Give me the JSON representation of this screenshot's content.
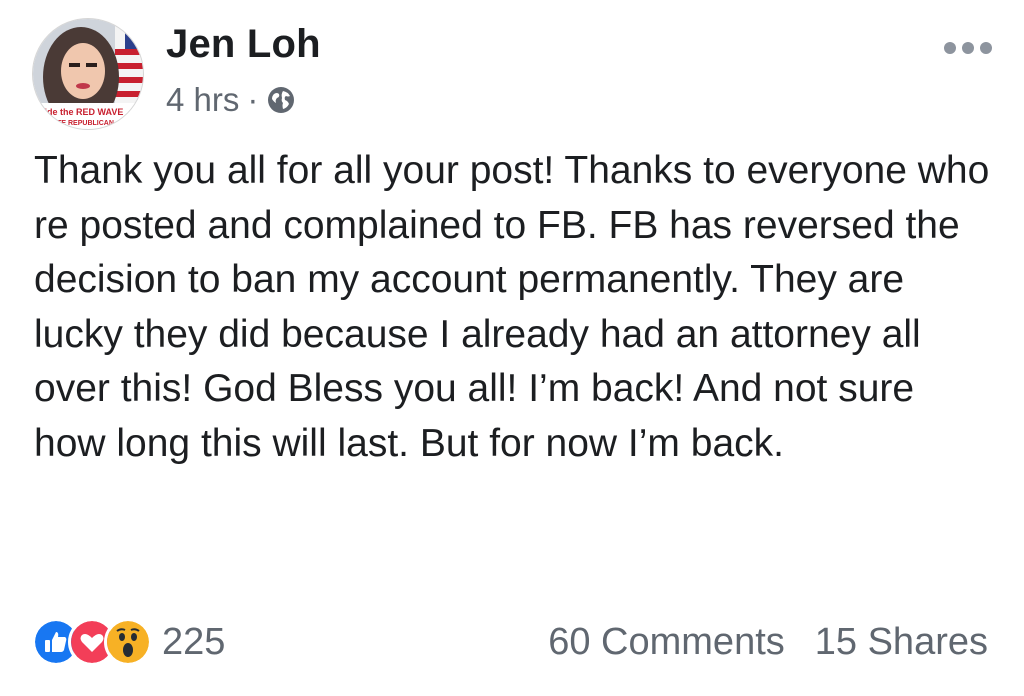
{
  "post": {
    "author": "Jen Loh",
    "timestamp": "4 hrs",
    "separator": "·",
    "privacy_icon": "globe-icon",
    "more_icon": "more-dots-icon",
    "avatar_banner_top": "Ride the RED WAVE",
    "avatar_banner_bottom": "VOTE REPUBLICAN",
    "body": "Thank you all for all your post! Thanks to everyone who re posted and complained to FB. FB has reversed the decision to ban my account permanently. They are lucky they did because I already had an attorney all over this! God Bless you all! I’m back! And not sure how long this will last. But for now I’m back."
  },
  "footer": {
    "reaction_icons": [
      "like-icon",
      "love-icon",
      "wow-icon"
    ],
    "reaction_count": "225",
    "comments": "60 Comments",
    "shares": "15 Shares"
  },
  "colors": {
    "text": "#1c1e21",
    "secondary": "#606770",
    "like": "#1877f2",
    "love": "#f33e58",
    "wow": "#f7b125"
  }
}
